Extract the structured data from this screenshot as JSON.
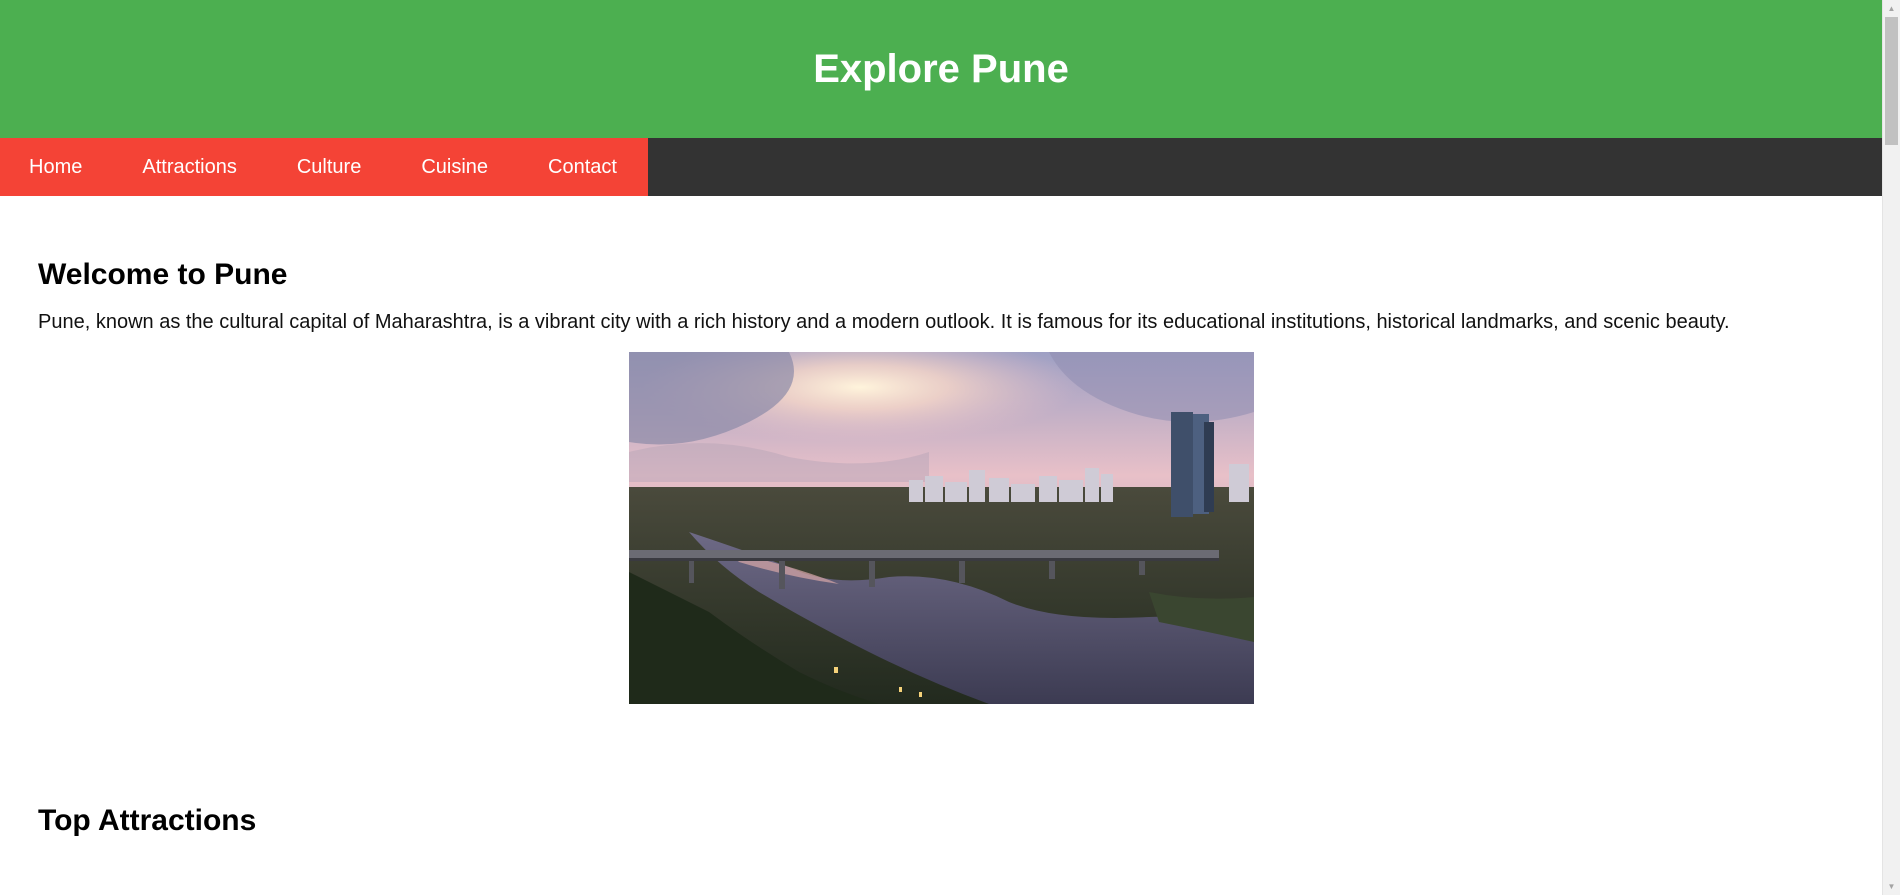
{
  "header": {
    "title": "Explore Pune"
  },
  "nav": {
    "items": [
      {
        "label": "Home"
      },
      {
        "label": "Attractions"
      },
      {
        "label": "Culture"
      },
      {
        "label": "Cuisine"
      },
      {
        "label": "Contact"
      }
    ]
  },
  "welcome": {
    "heading": "Welcome to Pune",
    "text": "Pune, known as the cultural capital of Maharashtra, is a vibrant city with a rich history and a modern outlook. It is famous for its educational institutions, historical landmarks, and scenic beauty."
  },
  "hero_image": {
    "icon": "pune-skyline-photo"
  },
  "attractions": {
    "heading": "Top Attractions"
  },
  "colors": {
    "header_bg": "#4caf50",
    "nav_bg": "#333333",
    "nav_links_bg": "#f44336"
  }
}
